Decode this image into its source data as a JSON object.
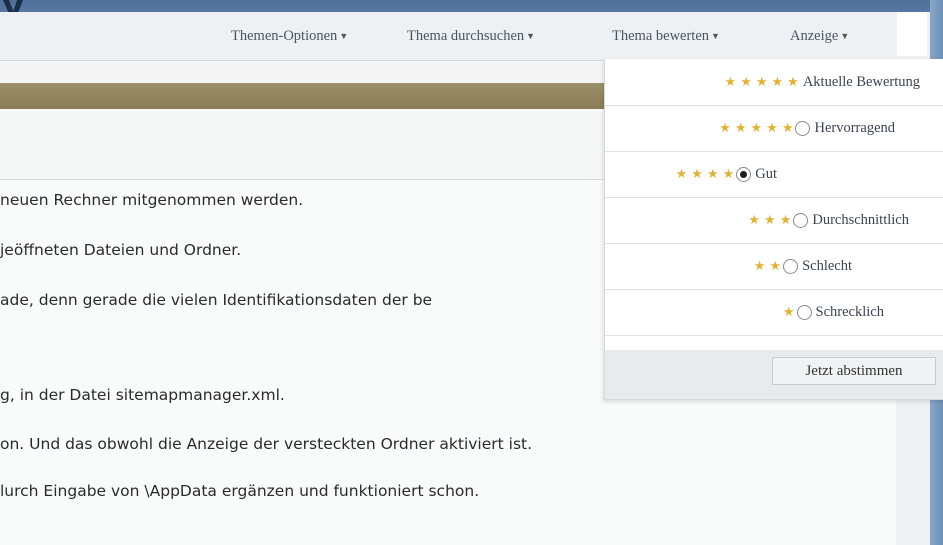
{
  "toolbar": {
    "items": [
      {
        "label": "Themen-Optionen"
      },
      {
        "label": "Thema durchsuchen"
      },
      {
        "label": "Thema bewerten"
      },
      {
        "label": "Anzeige"
      }
    ]
  },
  "content": {
    "lines": [
      "neuen Rechner mitgenommen werden.",
      "jeöffneten Dateien und Ordner.",
      "ade, denn gerade die vielen Identifikationsdaten der be",
      "g, in der Datei sitemapmanager.xml.",
      "on. Und das obwohl die Anzeige der versteckten Ordner aktiviert ist.",
      "lurch Eingabe von \\AppData ergänzen und funktioniert schon."
    ]
  },
  "rating_menu": {
    "current_label": "Aktuelle Bewertung",
    "current_stars": 5,
    "options": [
      {
        "label": "Hervorragend",
        "stars": 5,
        "selected": false
      },
      {
        "label": "Gut",
        "stars": 4,
        "selected": true
      },
      {
        "label": "Durchschnittlich",
        "stars": 3,
        "selected": false
      },
      {
        "label": "Schlecht",
        "stars": 2,
        "selected": false
      },
      {
        "label": "Schrecklich",
        "stars": 1,
        "selected": false
      }
    ],
    "submit_label": "Jetzt abstimmen"
  },
  "colors": {
    "star": "#e0b23a",
    "header_bar": "#9c9069",
    "window_frame": "#5d7fa6"
  }
}
